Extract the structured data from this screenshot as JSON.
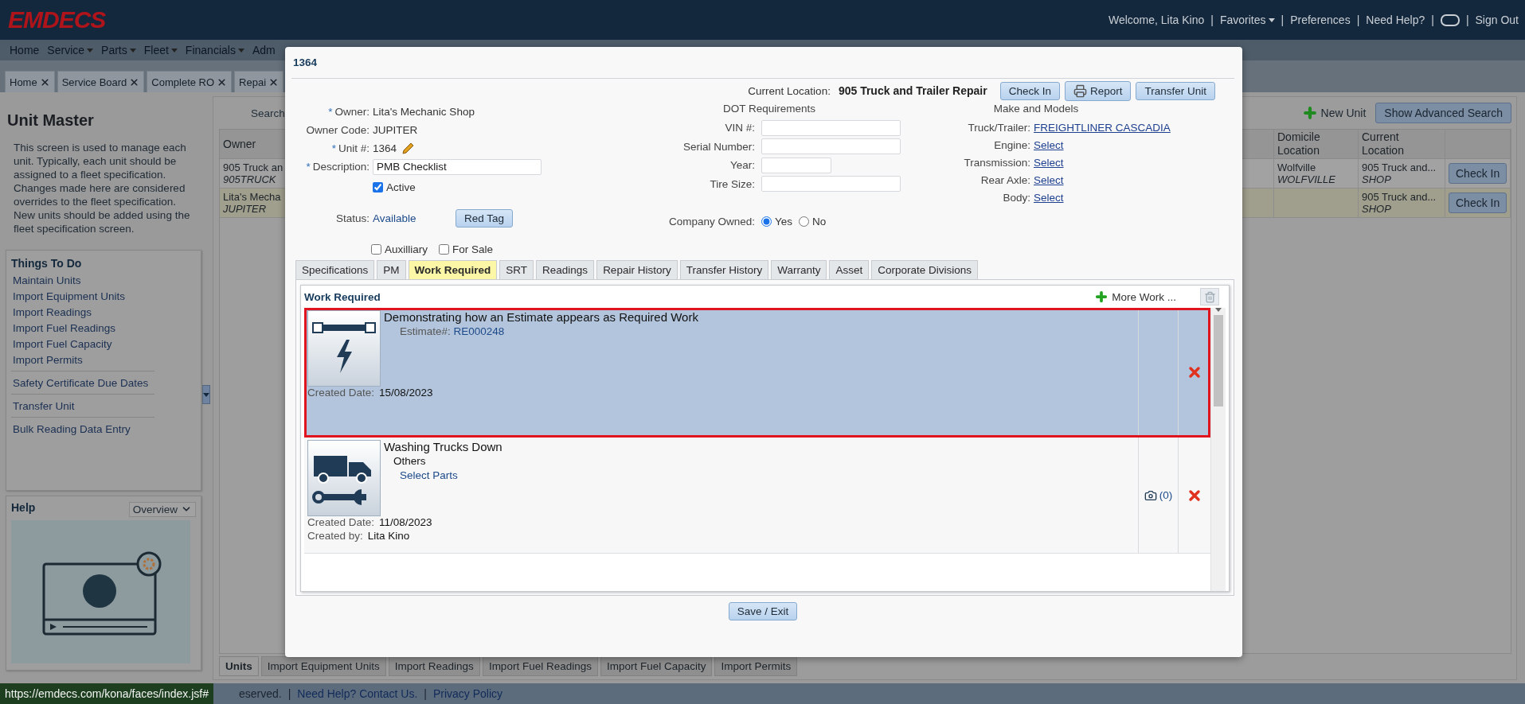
{
  "header": {
    "logo": "EMDECS",
    "items": [
      {
        "kind": "text",
        "label": "Welcome, Lita Kino"
      },
      {
        "kind": "sep",
        "label": "|"
      },
      {
        "kind": "menu",
        "label": "Favorites"
      },
      {
        "kind": "sep",
        "label": "|"
      },
      {
        "kind": "link",
        "label": "Preferences"
      },
      {
        "kind": "sep",
        "label": "|"
      },
      {
        "kind": "link",
        "label": "Need Help?"
      },
      {
        "kind": "sep",
        "label": "|"
      },
      {
        "kind": "toggle"
      },
      {
        "kind": "sep",
        "label": "|"
      },
      {
        "kind": "link",
        "label": "Sign Out"
      }
    ]
  },
  "menu": [
    {
      "label": "Home",
      "dropdown": false
    },
    {
      "label": "Service",
      "dropdown": true
    },
    {
      "label": "Parts",
      "dropdown": true
    },
    {
      "label": "Fleet",
      "dropdown": true
    },
    {
      "label": "Financials",
      "dropdown": true
    },
    {
      "label": "Adm",
      "dropdown": false
    }
  ],
  "page_tabs": [
    {
      "label": "Home"
    },
    {
      "label": "Service Board"
    },
    {
      "label": "Complete RO"
    },
    {
      "label": "Repai"
    }
  ],
  "sidebar": {
    "title": "Unit Master",
    "description": "This screen is used to manage each unit. Typically, each unit should be assigned to a fleet specification. Changes made here are considered overrides to the fleet specification. New units should be added using the fleet specification screen.",
    "todo": {
      "title": "Things To Do",
      "groups": [
        [
          "Maintain Units",
          "Import Equipment Units",
          "Import Readings",
          "Import Fuel Readings",
          "Import Fuel Capacity",
          "Import Permits"
        ],
        [
          "Safety Certificate Due Dates"
        ],
        [
          "Transfer Unit"
        ],
        [
          "Bulk Reading Data Entry"
        ]
      ]
    },
    "help": {
      "title": "Help",
      "select": "Overview"
    }
  },
  "units": {
    "search_label": "Search",
    "new_unit": "New Unit",
    "advanced_search": "Show Advanced Search",
    "columns": [
      {
        "label": "Owner"
      },
      {
        "label": "Domicile Location"
      },
      {
        "label": "Current Location"
      }
    ],
    "rows": [
      {
        "owner": "905 Truck an",
        "owner_code": "905TRUCK",
        "domicile": "Wolfville",
        "domicile_code": "WOLFVILLE",
        "location": "905 Truck and...",
        "location_code": "SHOP",
        "action": "Check In",
        "selected": false
      },
      {
        "owner": "Lita's Mecha",
        "owner_code": "JUPITER",
        "location": "905 Truck and...",
        "location_code": "SHOP",
        "action": "Check In",
        "selected": true
      }
    ],
    "bottom_tabs": [
      {
        "label": "Units",
        "selected": true
      },
      {
        "label": "Import Equipment Units",
        "selected": false
      },
      {
        "label": "Import Readings",
        "selected": false
      },
      {
        "label": "Import Fuel Readings",
        "selected": false
      },
      {
        "label": "Import Fuel Capacity",
        "selected": false
      },
      {
        "label": "Import Permits",
        "selected": false
      }
    ]
  },
  "footer": {
    "items": [
      {
        "kind": "text",
        "label": "eserved."
      },
      {
        "kind": "sep",
        "label": "|"
      },
      {
        "kind": "link",
        "label": "Need Help? Contact Us."
      },
      {
        "kind": "sep",
        "label": "|"
      },
      {
        "kind": "link",
        "label": "Privacy Policy"
      }
    ],
    "status_url": "https://emdecs.com/kona/faces/index.jsf#"
  },
  "modal": {
    "title": "1364",
    "current_location_label": "Current Location:",
    "current_location": "905 Truck and Trailer Repair",
    "buttons": [
      {
        "label": "Check In",
        "icon": false
      },
      {
        "label": "Report",
        "icon": true
      },
      {
        "label": "Transfer Unit",
        "icon": false
      }
    ],
    "fields": [
      {
        "marker": "*",
        "label": "Owner:",
        "value": "Lita's Mechanic Shop",
        "kind": "text"
      },
      {
        "label": "Owner Code:",
        "value": "JUPITER",
        "kind": "text"
      },
      {
        "marker": "*",
        "label": "Unit #:",
        "value": "1364",
        "kind": "edit"
      },
      {
        "marker": "*",
        "label": "Description:",
        "value": "PMB Checklist",
        "kind": "input"
      }
    ],
    "active": {
      "label": "Active",
      "checked": true
    },
    "status_label": "Status:",
    "status": "Available",
    "red_tag": "Red Tag",
    "dot": {
      "title": "DOT Requirements",
      "fields": [
        {
          "label": "VIN #:",
          "kind": "long"
        },
        {
          "label": "Serial Number:",
          "kind": "long"
        },
        {
          "label": "Year:",
          "kind": "short"
        },
        {
          "label": "Tire Size:",
          "kind": "long"
        }
      ]
    },
    "company_owned": {
      "label": "Company Owned:",
      "options": [
        {
          "label": "Yes",
          "selected": true
        },
        {
          "label": "No",
          "selected": false
        }
      ]
    },
    "make_models": {
      "title": "Make and Models",
      "items": [
        {
          "label": "Truck/Trailer:",
          "value": "FREIGHTLINER CASCADIA"
        },
        {
          "label": "Engine:",
          "value": "Select"
        },
        {
          "label": "Transmission:",
          "value": "Select"
        },
        {
          "label": "Rear Axle:",
          "value": "Select"
        },
        {
          "label": "Body:",
          "value": "Select"
        }
      ]
    },
    "flags": [
      {
        "label": "Auxilliary",
        "checked": false
      },
      {
        "label": "For Sale",
        "checked": false
      }
    ],
    "tabs": [
      {
        "label": "Specifications",
        "selected": false
      },
      {
        "label": "PM",
        "selected": false
      },
      {
        "label": "Work Required",
        "selected": true
      },
      {
        "label": "SRT",
        "selected": false
      },
      {
        "label": "Readings",
        "selected": false
      },
      {
        "label": "Repair History",
        "selected": false
      },
      {
        "label": "Transfer History",
        "selected": false
      },
      {
        "label": "Warranty",
        "selected": false
      },
      {
        "label": "Asset",
        "selected": false
      },
      {
        "label": "Corporate Divisions",
        "selected": false
      }
    ],
    "work": {
      "title": "Work Required",
      "more": "More Work ...",
      "items": [
        {
          "kind": "estimate",
          "selected": true,
          "title": "Demonstrating how an Estimate appears as Required Work",
          "detail_label": "Estimate#:",
          "detail_value": "RE000248",
          "created_label": "Created Date:",
          "created": "15/08/2023"
        },
        {
          "kind": "service",
          "selected": false,
          "title": "Washing Trucks Down",
          "category": "Others",
          "link": "Select Parts",
          "created_label": "Created Date:",
          "created": "11/08/2023",
          "by_label": "Created by:",
          "by": "Lita Kino",
          "photos": "(0)"
        }
      ]
    },
    "save": "Save / Exit"
  }
}
